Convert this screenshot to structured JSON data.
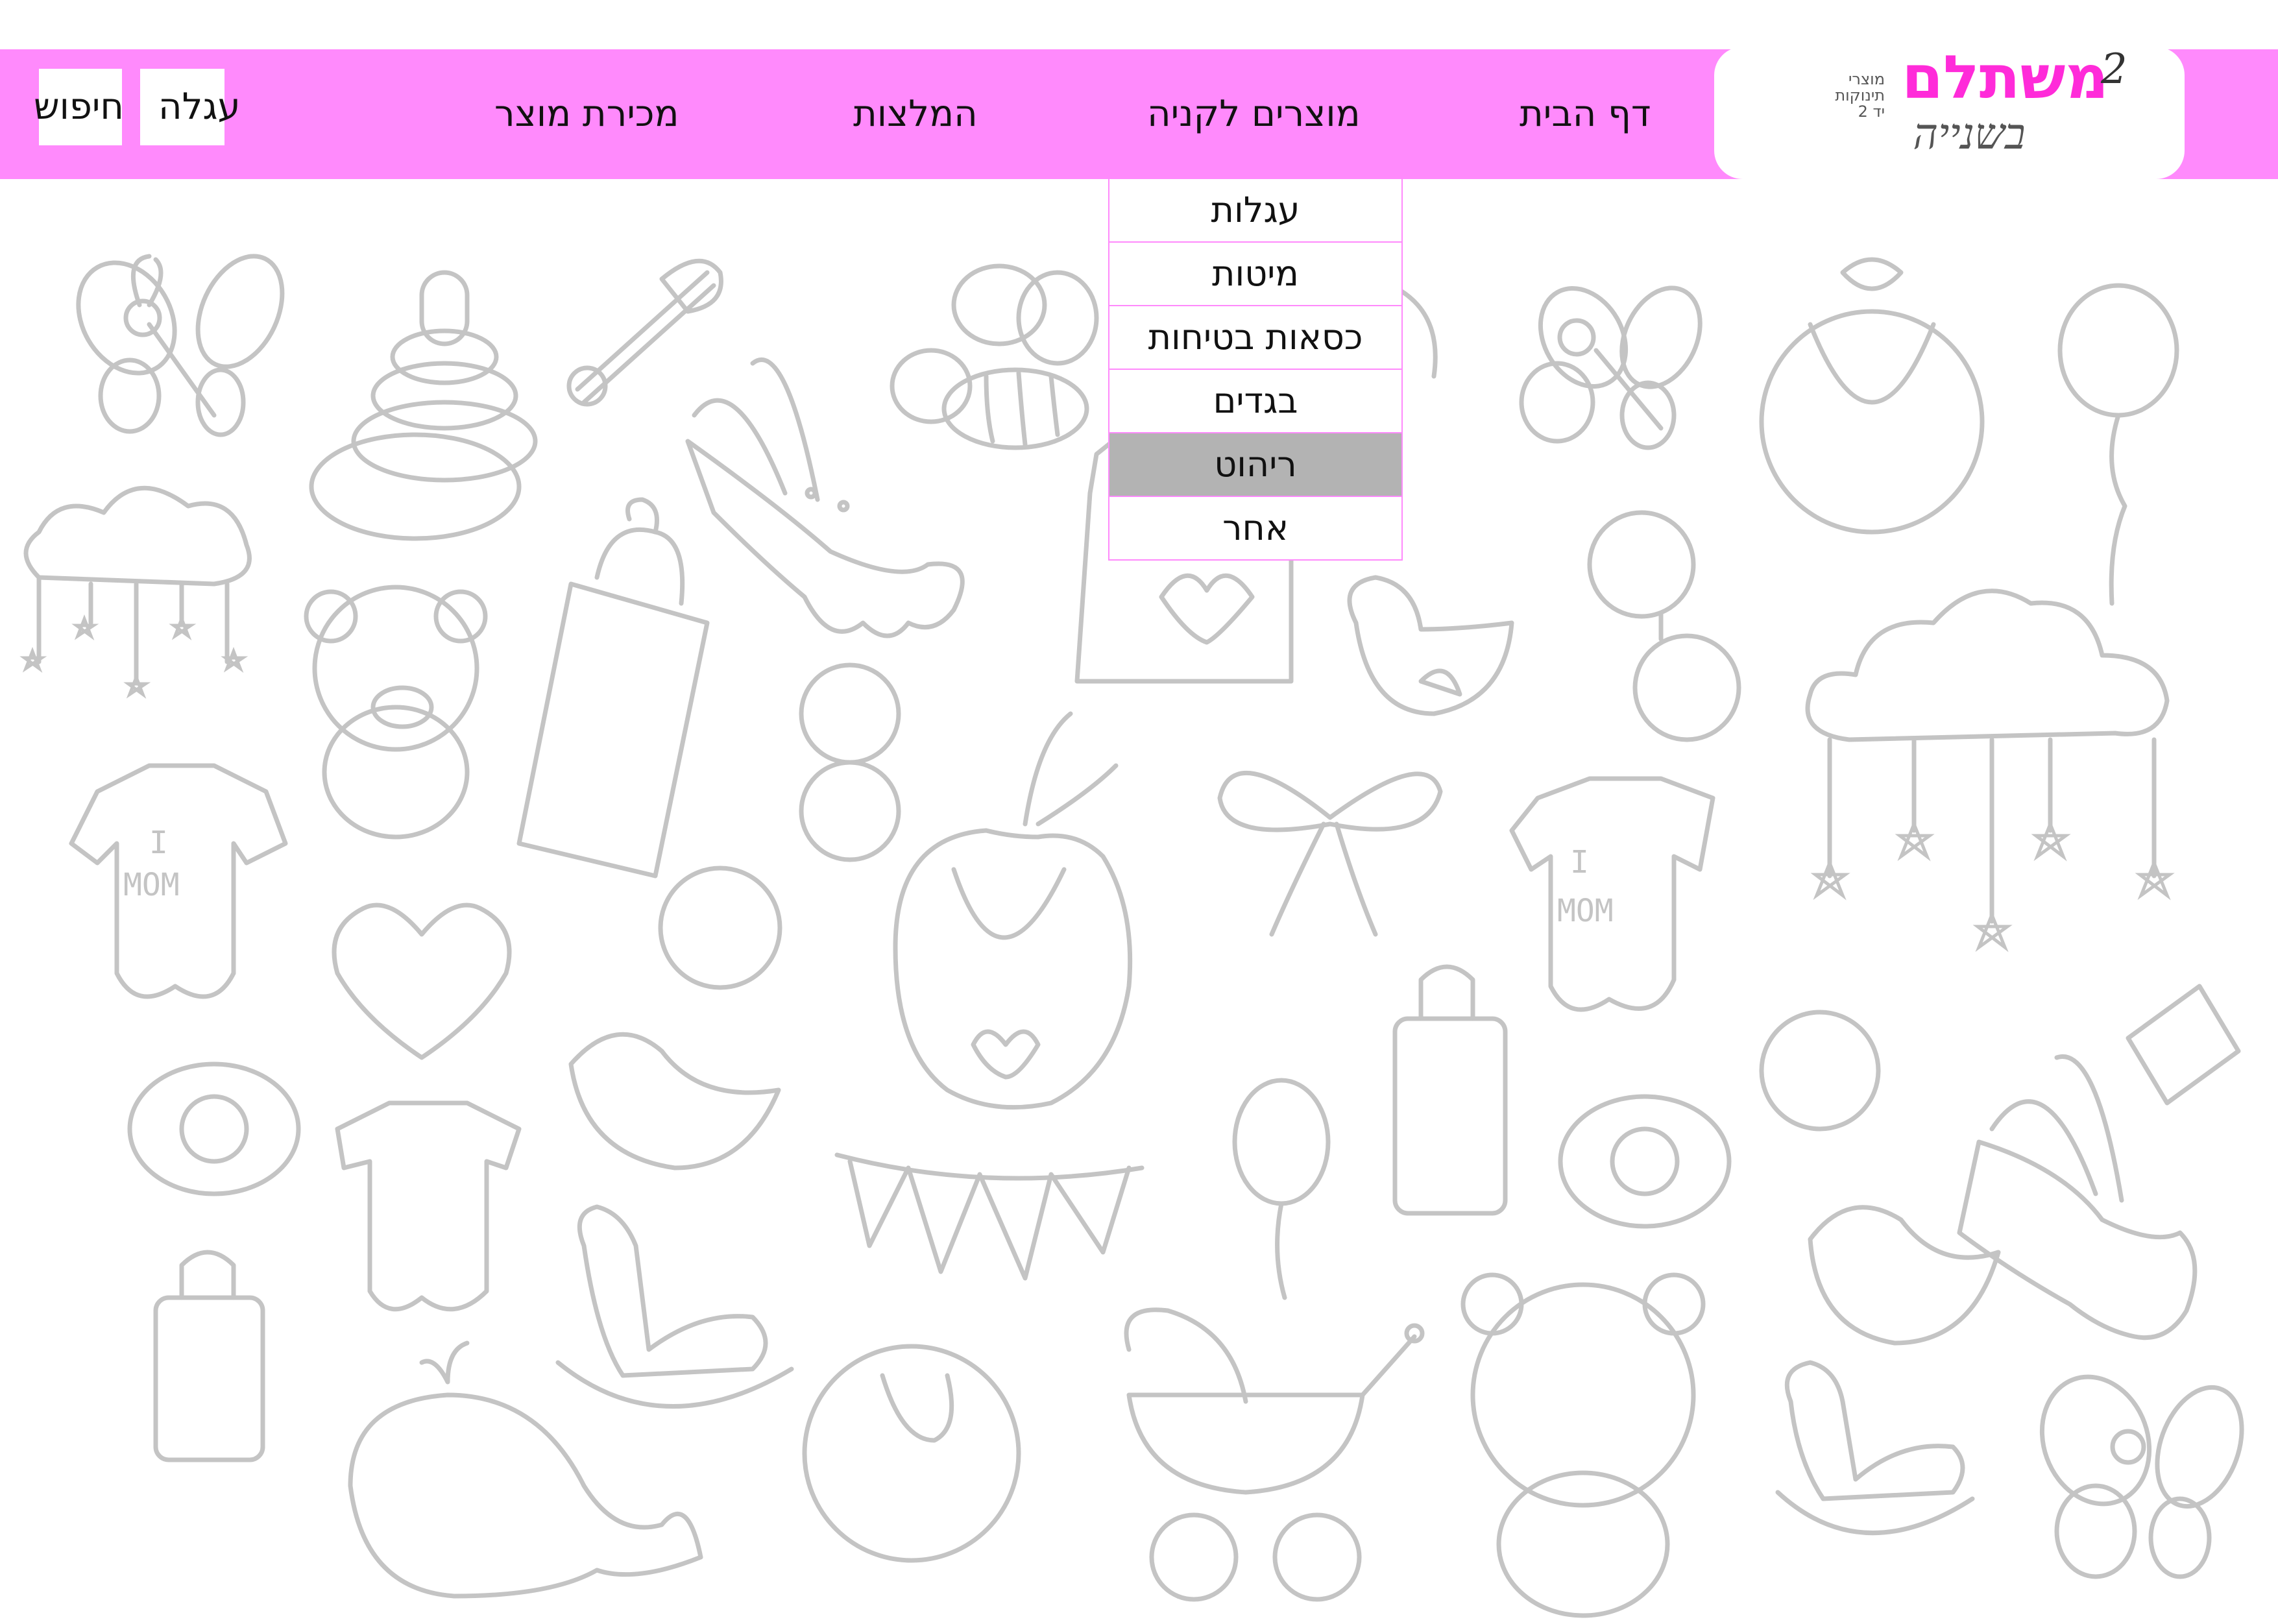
{
  "colors": {
    "nav_background": "#ff8afc",
    "brand_pink": "#ff2bd9",
    "dropdown_active": "#b3b3b3",
    "doodle_gray": "#c4c4c4"
  },
  "logo": {
    "main": "משתלם",
    "superscript": "2",
    "subtitle_lines": [
      "מוצרי",
      "תינוקות",
      "יד 2"
    ],
    "script": "בשנייה"
  },
  "nav": {
    "home": "דף הבית",
    "products": "מוצרים לקניה",
    "recommendations": "המלצות",
    "sell": "מכירת מוצר",
    "cart": "עגלה",
    "search": "חיפוש"
  },
  "dropdown": {
    "items": [
      {
        "label": "עגלות",
        "icon": "stroller-icon"
      },
      {
        "label": "מיטות",
        "icon": "bed-icon"
      },
      {
        "label": "כסאות בטיחות",
        "icon": "car-seat-icon"
      },
      {
        "label": "בגדים",
        "icon": "clothes-icon"
      },
      {
        "label": "ריהוט",
        "icon": "furniture-icon",
        "active": true
      },
      {
        "label": "אחר",
        "icon": "other-icon"
      }
    ]
  },
  "background": {
    "pattern": "baby doodles",
    "doodles": [
      "butterfly-icon",
      "ring-stacker-icon",
      "safety-pin-icon",
      "bee-icon",
      "bunny-icon",
      "balloon-icon",
      "bib-icon",
      "cloud-mobile-icon",
      "teddy-bear-icon",
      "baby-bottle-icon",
      "onesie-icon",
      "rattle-icon",
      "bird-icon",
      "bow-icon",
      "heart-icon",
      "baby-face-icon",
      "pacifier-icon",
      "rocking-horse-icon",
      "whale-icon",
      "stroller-icon",
      "bunting-icon"
    ],
    "onesie_text": [
      "I",
      "MOM"
    ]
  }
}
